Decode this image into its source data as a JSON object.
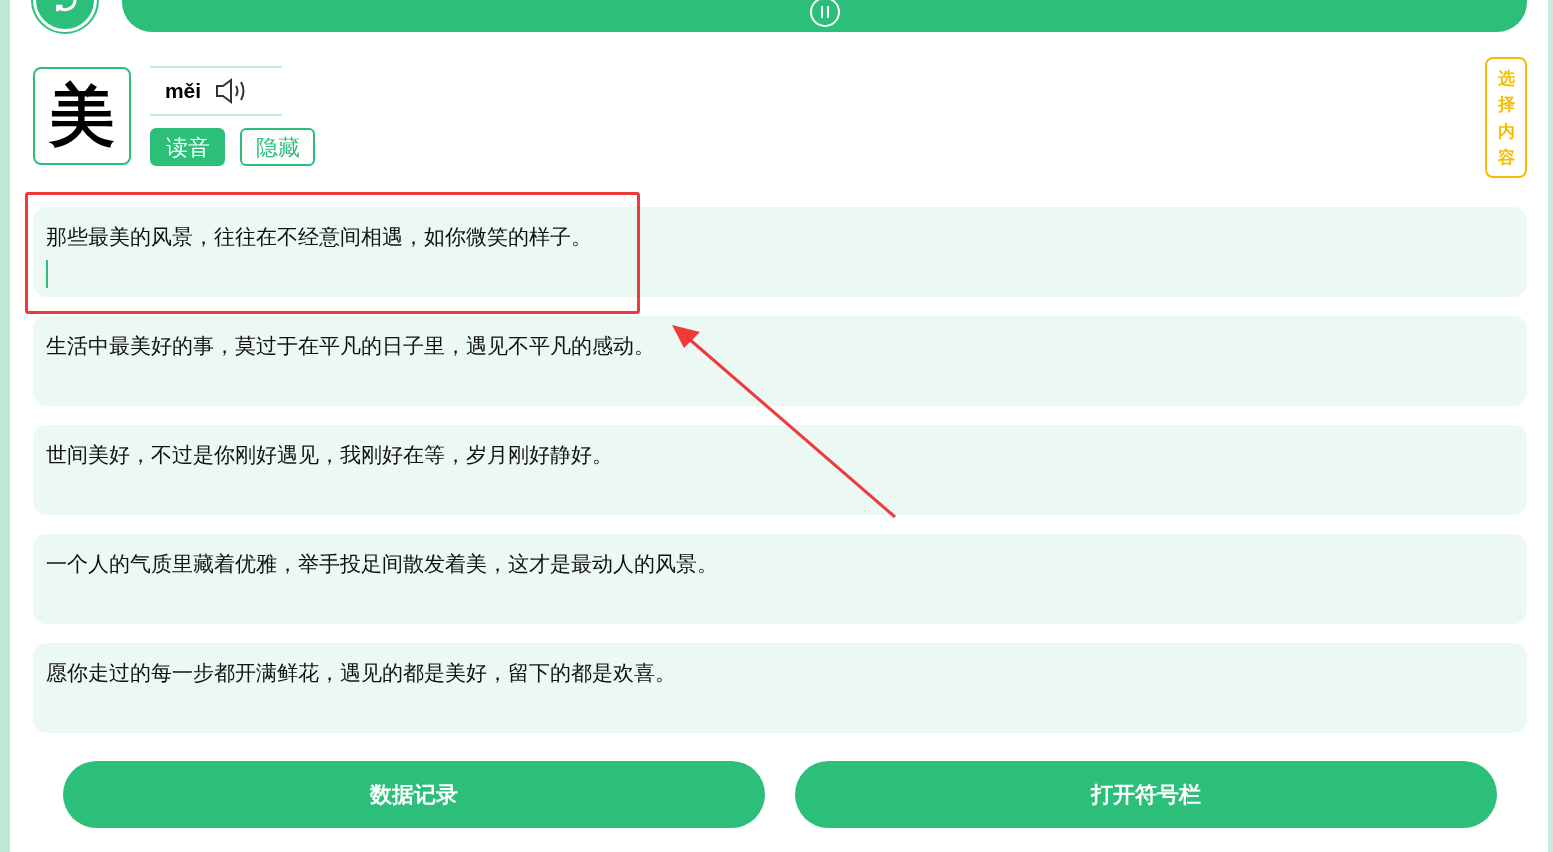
{
  "character": {
    "glyph": "美",
    "pinyin": "měi"
  },
  "actions": [
    {
      "label": "读音",
      "kind": "filled"
    },
    {
      "label": "隐藏",
      "kind": "outline"
    }
  ],
  "side_button": {
    "label": "选择内容"
  },
  "sentences": [
    {
      "text": "那些最美的风景，往往在不经意间相遇，如你微笑的样子。",
      "focused": true
    },
    {
      "text": "生活中最美好的事，莫过于在平凡的日子里，遇见不平凡的感动。",
      "focused": false
    },
    {
      "text": "世间美好，不过是你刚好遇见，我刚好在等，岁月刚好静好。",
      "focused": false
    },
    {
      "text": "一个人的气质里藏着优雅，举手投足间散发着美，这才是最动人的风景。",
      "focused": false
    },
    {
      "text": "愿你走过的每一步都开满鲜花，遇见的都是美好，留下的都是欢喜。",
      "focused": false
    }
  ],
  "bottom_buttons": [
    "数据记录",
    "打开符号栏"
  ]
}
